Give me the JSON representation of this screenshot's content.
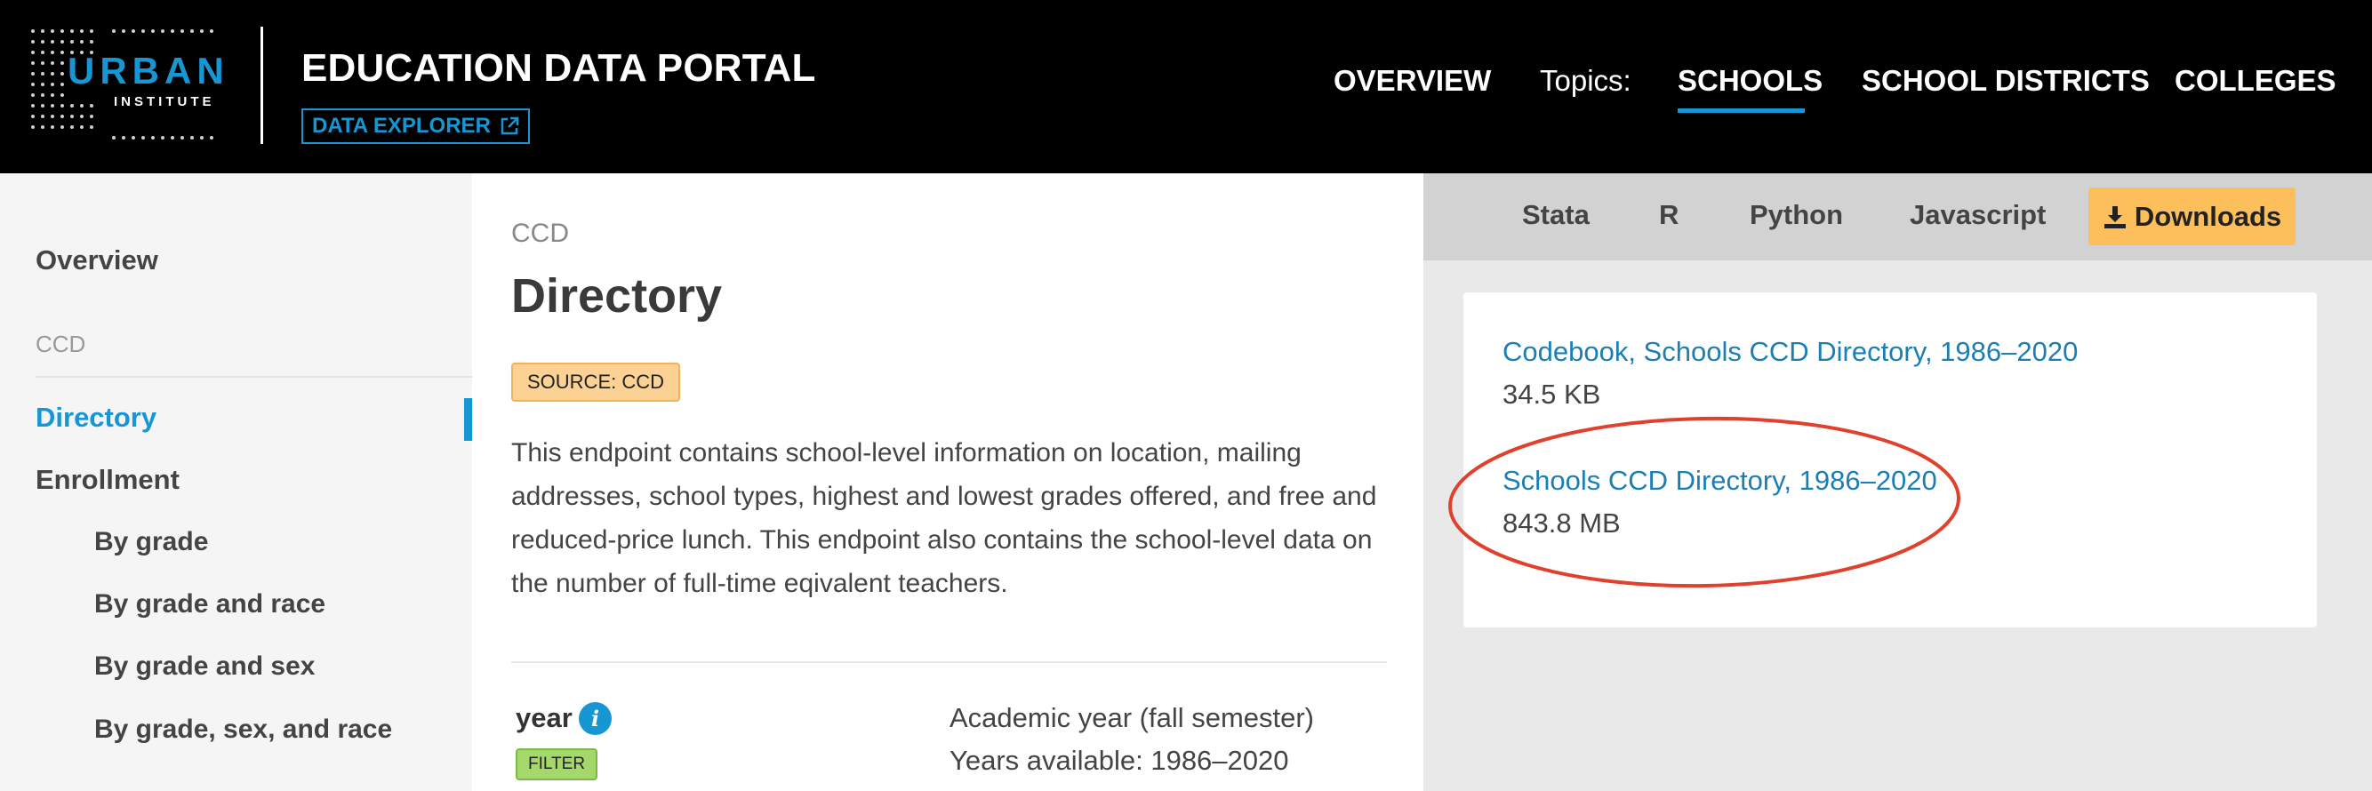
{
  "header": {
    "logo_top": "URBAN",
    "logo_bottom": "INSTITUTE",
    "title": "EDUCATION DATA PORTAL",
    "explorer_label": "DATA EXPLORER",
    "nav": {
      "overview": "OVERVIEW",
      "topics": "Topics:",
      "schools": "SCHOOLS",
      "districts": "SCHOOL DISTRICTS",
      "colleges": "COLLEGES"
    },
    "accent_color": "#1696d2"
  },
  "sidebar": {
    "overview": "Overview",
    "section": "CCD",
    "active_item": "Directory",
    "group": "Enrollment",
    "sub_items": [
      "By grade",
      "By grade and race",
      "By grade and sex",
      "By grade, sex, and race"
    ]
  },
  "main": {
    "eyebrow": "CCD",
    "title": "Directory",
    "source_badge": "SOURCE: CCD",
    "description": "This endpoint contains school-level information on location, mailing addresses, school types, highest and lowest grades offered, and free and reduced-price lunch. This endpoint also contains the school-level data on the number of full-time eqivalent teachers.",
    "field": {
      "name": "year",
      "badge": "FILTER",
      "description": "Academic year (fall semester)",
      "years": "Years available: 1986–2020"
    }
  },
  "panel": {
    "tabs": [
      "Stata",
      "R",
      "Python",
      "Javascript"
    ],
    "downloads_label": "Downloads",
    "downloads_color": "#fdbf5c",
    "files": [
      {
        "name": "Codebook, Schools CCD Directory, 1986–2020",
        "size": "34.5 KB"
      },
      {
        "name": "Schools CCD Directory, 1986–2020",
        "size": "843.8 MB"
      }
    ],
    "highlight_color": "#e0412c"
  }
}
